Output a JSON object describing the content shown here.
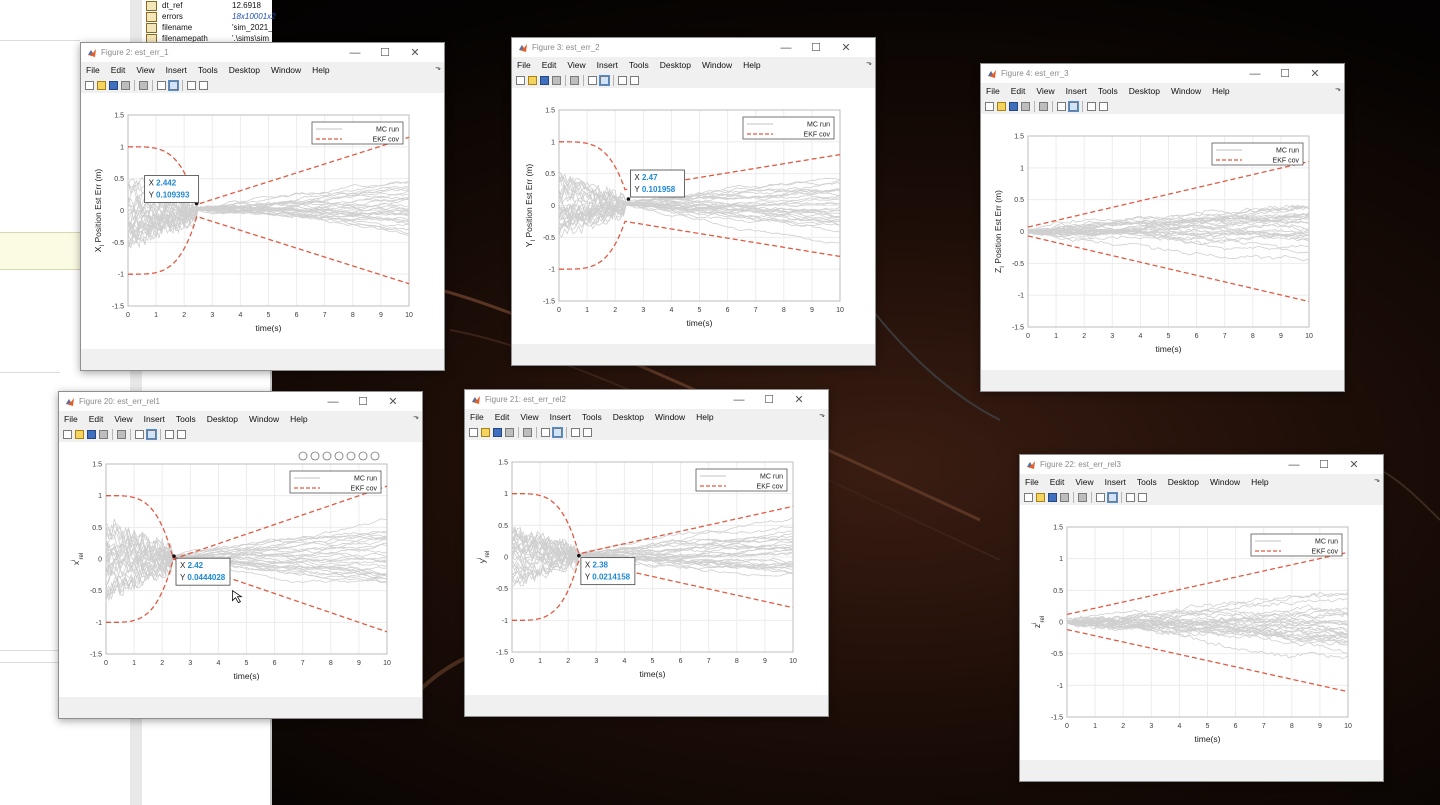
{
  "workspace": {
    "rows": [
      {
        "name": "dt_ref",
        "value": "12.6918",
        "italic": false
      },
      {
        "name": "errors",
        "value": "18x10001x2",
        "italic": true
      },
      {
        "name": "filename",
        "value": "'sim_2021_",
        "italic": false
      },
      {
        "name": "filenamepath",
        "value": "'.\\sims\\sim",
        "italic": false
      }
    ]
  },
  "window_controls": {
    "minimize": "—",
    "maximize": "☐",
    "close": "✕"
  },
  "menu": [
    "File",
    "Edit",
    "View",
    "Insert",
    "Tools",
    "Desktop",
    "Window",
    "Help"
  ],
  "axes_toolbar_icons": [
    "brush-icon",
    "datatip-icon",
    "rotate-icon",
    "pan-icon",
    "zoom-in-icon",
    "zoom-out-icon",
    "home-icon"
  ],
  "shared_axes": {
    "xlabel": "time(s)",
    "xticks": [
      "0",
      "1",
      "2",
      "3",
      "4",
      "5",
      "6",
      "7",
      "8",
      "9",
      "10"
    ],
    "yticks": [
      "-1.5",
      "-1",
      "-0.5",
      "0",
      "0.5",
      "1",
      "1.5"
    ],
    "xlim": [
      0,
      10
    ],
    "ylim": [
      -1.5,
      1.5
    ],
    "grid": true,
    "legend_position": "top-right",
    "legend": [
      {
        "label": "MC run",
        "color": "#cfcfcf",
        "style": "solid"
      },
      {
        "label": "EKF cov",
        "color": "#e05a42",
        "style": "dashed"
      }
    ]
  },
  "figures": [
    {
      "title": "Figure 2: est_err_1",
      "ylabel_main": "X",
      "ylabel_sub": "I",
      "ylabel_rest": " Position Est Err (m)",
      "cov_start": 1.0,
      "cov_drop_end": 0.095,
      "cov_drop_x": 2.45,
      "cov_end": 1.15,
      "mc_amp": 0.55,
      "mc_growth": 0.6,
      "datatip": {
        "x": "2.442",
        "y": "0.109393",
        "xval": 2.442,
        "yval": 0.109393
      }
    },
    {
      "title": "Figure 3: est_err_2",
      "ylabel_main": "Y",
      "ylabel_sub": "I",
      "ylabel_rest": " Position Est Err (m)",
      "cov_start": 1.0,
      "cov_drop_end": 0.25,
      "cov_drop_x": 2.35,
      "cov_end": 0.8,
      "mc_amp": 0.45,
      "mc_growth": 0.55,
      "datatip": {
        "x": "2.47",
        "y": "0.101958",
        "xval": 2.47,
        "yval": 0.101958
      }
    },
    {
      "title": "Figure 4: est_err_3",
      "ylabel_main": "Z",
      "ylabel_sub": "I",
      "ylabel_rest": " Position Est Err (m)",
      "cov_start": 0.07,
      "cov_drop_end": 0.07,
      "cov_drop_x": 0.0,
      "cov_end": 1.1,
      "mc_amp": 0.05,
      "mc_growth": 0.5,
      "datatip": null
    },
    {
      "title": "Figure 20: est_err_rel1",
      "ylabel_main": "x",
      "ylabel_sub": "rel",
      "ylabel_sup": "i",
      "ylabel_rest": "",
      "cov_start": 1.0,
      "cov_drop_end": 0.0,
      "cov_drop_x": 2.4,
      "cov_end": 1.15,
      "mc_amp": 0.6,
      "mc_growth": 0.6,
      "datatip": {
        "x": "2.42",
        "y": "0.0444028",
        "xval": 2.42,
        "yval": 0.0444028
      },
      "axes_toolbar": true
    },
    {
      "title": "Figure 21: est_err_rel2",
      "ylabel_main": "y",
      "ylabel_sub": "rel",
      "ylabel_sup": "i",
      "ylabel_rest": "",
      "cov_start": 1.0,
      "cov_drop_end": 0.05,
      "cov_drop_x": 2.38,
      "cov_end": 0.8,
      "mc_amp": 0.45,
      "mc_growth": 0.55,
      "datatip": {
        "x": "2.38",
        "y": "0.0214158",
        "xval": 2.38,
        "yval": 0.0214158
      }
    },
    {
      "title": "Figure 22: est_err_rel3",
      "ylabel_main": "z",
      "ylabel_sub": "rel",
      "ylabel_sup": "i",
      "ylabel_rest": "",
      "cov_start": 0.12,
      "cov_drop_end": 0.12,
      "cov_drop_x": 0.0,
      "cov_end": 1.1,
      "mc_amp": 0.08,
      "mc_growth": 0.5,
      "datatip": null
    }
  ]
}
